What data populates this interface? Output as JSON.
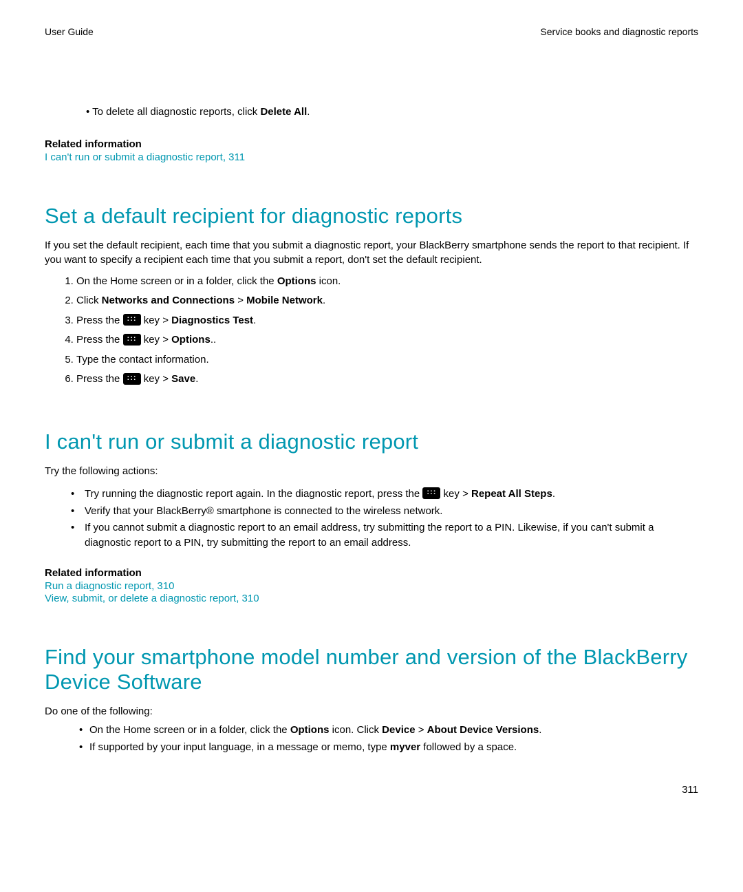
{
  "header": {
    "left": "User Guide",
    "right": "Service books and diagnostic reports"
  },
  "top_bullet": {
    "prefix": "To delete all diagnostic reports, click ",
    "bold": "Delete All",
    "suffix": "."
  },
  "related1": {
    "heading": "Related information",
    "link": "I can't run or submit a diagnostic report, 311"
  },
  "section1": {
    "title": "Set a default recipient for diagnostic reports",
    "intro": "If you set the default recipient, each time that you submit a diagnostic report, your BlackBerry smartphone sends the report to that recipient. If you want to specify a recipient each time that you submit a report, don't set the default recipient.",
    "step1_pre": "On the Home screen or in a folder, click the ",
    "step1_bold": "Options",
    "step1_suf": " icon.",
    "step2_pre": "Click ",
    "step2_b1": "Networks and Connections",
    "step2_gt": " > ",
    "step2_b2": "Mobile Network",
    "step2_suf": ".",
    "step3_pre": "Press the ",
    "step3_mid": " key > ",
    "step3_bold": "Diagnostics Test",
    "step3_suf": ".",
    "step4_pre": "Press the ",
    "step4_mid": " key > ",
    "step4_bold": "Options",
    "step4_suf": "..",
    "step5": "Type the contact information.",
    "step6_pre": "Press the ",
    "step6_mid": " key > ",
    "step6_bold": "Save",
    "step6_suf": "."
  },
  "section2": {
    "title": "I can't run or submit a diagnostic report",
    "intro": "Try the following actions:",
    "b1_pre": "Try running the diagnostic report again. In the diagnostic report, press the ",
    "b1_mid": " key > ",
    "b1_bold": "Repeat All Steps",
    "b1_suf": ".",
    "b2": "Verify that your BlackBerry® smartphone is connected to the wireless network.",
    "b3": "If you cannot submit a diagnostic report to an email address, try submitting the report to a PIN. Likewise, if you can't submit a diagnostic report to a PIN, try submitting the report to an email address."
  },
  "related2": {
    "heading": "Related information",
    "link1": "Run a diagnostic report, 310",
    "link2": "View, submit, or delete a diagnostic report, 310"
  },
  "section3": {
    "title": "Find your smartphone model number and version of the BlackBerry Device Software",
    "intro": "Do one of the following:",
    "b1_pre": "On the Home screen or in a folder, click the ",
    "b1_b1": "Options",
    "b1_mid1": " icon. Click ",
    "b1_b2": "Device",
    "b1_gt": " > ",
    "b1_b3": "About Device Versions",
    "b1_suf": ".",
    "b2_pre": "If supported by your input language, in a message or memo, type ",
    "b2_bold": "myver",
    "b2_suf": " followed by a space."
  },
  "page_number": "311"
}
